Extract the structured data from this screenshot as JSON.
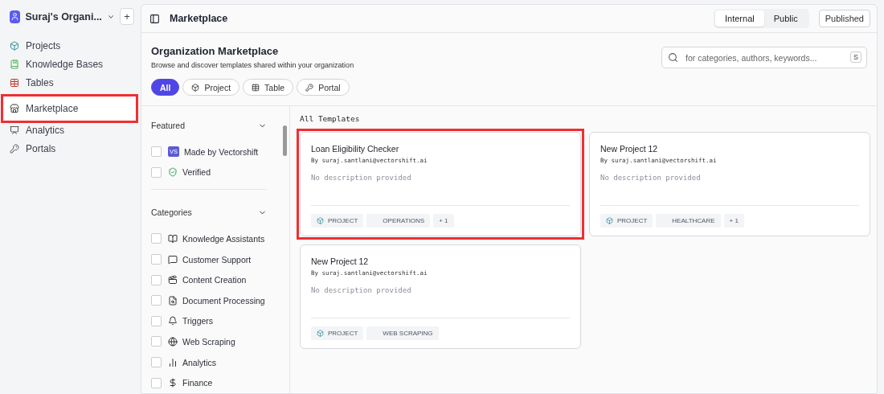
{
  "workspace": {
    "name": "Suraj's Organi...",
    "add": "+"
  },
  "nav": [
    {
      "label": "Projects",
      "selected": false,
      "highlighted": false
    },
    {
      "label": "Knowledge Bases",
      "selected": false,
      "highlighted": false
    },
    {
      "label": "Tables",
      "selected": false,
      "highlighted": false
    },
    {
      "label": "Marketplace",
      "selected": true,
      "highlighted": true
    },
    {
      "label": "Analytics",
      "selected": false,
      "highlighted": false
    },
    {
      "label": "Portals",
      "selected": false,
      "highlighted": false
    }
  ],
  "header": {
    "title": "Marketplace",
    "scope_tabs": [
      {
        "label": "Internal",
        "selected": true
      },
      {
        "label": "Public",
        "selected": false
      }
    ],
    "published": "Published"
  },
  "hero": {
    "title": "Organization Marketplace",
    "subtitle": "Browse and discover templates shared within your organization",
    "search": {
      "placeholder": "for categories, authors, keywords...",
      "shortcut": "S"
    }
  },
  "type_filters": [
    {
      "label": "All",
      "selected": true
    },
    {
      "label": "Project",
      "selected": false
    },
    {
      "label": "Table",
      "selected": false
    },
    {
      "label": "Portal",
      "selected": false
    }
  ],
  "featured": {
    "title": "Featured",
    "expanded": true,
    "items": [
      {
        "kind": "badge",
        "badge": "VS",
        "label": "Made by Vectorshift",
        "checked": false
      },
      {
        "kind": "verified",
        "label": "Verified",
        "checked": false
      }
    ]
  },
  "categories": {
    "title": "Categories",
    "expanded": true,
    "items": [
      {
        "label": "Knowledge Assistants",
        "checked": false
      },
      {
        "label": "Customer Support",
        "checked": false
      },
      {
        "label": "Content Creation",
        "checked": false
      },
      {
        "label": "Document Processing",
        "checked": false
      },
      {
        "label": "Triggers",
        "checked": false
      },
      {
        "label": "Web Scraping",
        "checked": false
      },
      {
        "label": "Analytics",
        "checked": false
      },
      {
        "label": "Finance",
        "checked": false
      }
    ]
  },
  "templates": {
    "title": "All Templates",
    "cards": [
      {
        "title": "Loan Eligibility Checker",
        "by": "By",
        "author": "suraj.santlani@vectorshift.ai",
        "description": "No description provided",
        "type": "PROJECT",
        "category": "OPERATIONS",
        "more": "+ 1",
        "highlighted": true
      },
      {
        "title": "New Project 12",
        "by": "By",
        "author": "suraj.santlani@vectorshift.ai",
        "description": "No description provided",
        "type": "PROJECT",
        "category": "HEALTHCARE",
        "more": "+ 1",
        "highlighted": false
      },
      {
        "title": "New Project 12",
        "by": "By",
        "author": "suraj.santlani@vectorshift.ai",
        "description": "No description provided",
        "type": "PROJECT",
        "category": "WEB SCRAPING",
        "highlighted": false
      }
    ]
  }
}
